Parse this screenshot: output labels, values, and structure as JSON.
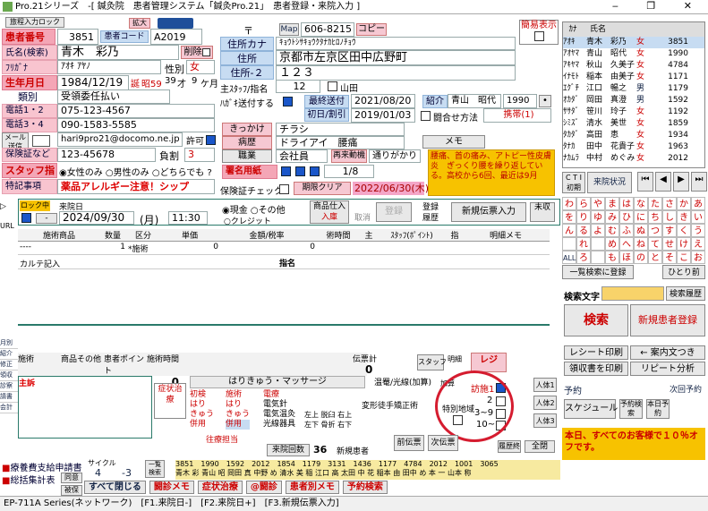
{
  "window": {
    "title": "Pro.21シリーズ　-[ 鍼灸院　患者管理システム「鍼灸Pro.21」　患者登録・来院入力 ]",
    "buttons": "‒ ❐ ✕"
  },
  "patient": {
    "sub_btn": "旅程入力ロック",
    "no_label": "患者番号",
    "no": "3851",
    "code_label": "患者コード",
    "code": "A2019",
    "enlarge": "拡大",
    "name_label": "氏名(検索)",
    "name": "青木　彩乃",
    "delete_btn": "削除",
    "kana_label": "ﾌﾘｶﾞﾅ",
    "kana": "ｱｵｷ ｱﾔﾉ",
    "sex_label": "性別",
    "sex": "女",
    "birth_label": "生年月日",
    "birth": "1984/12/19",
    "era": "誕",
    "age": "昭59",
    "age_y": "39",
    "age_y_u": "才",
    "age_m": "9",
    "age_m_u": "ケ月",
    "type_label": "類別",
    "type": "受領委任払い",
    "tel12_label": "電話1・2",
    "tel12": "075-123-4567",
    "tel34_label": "電話3・4",
    "tel34": "090-1583-5585",
    "mail_label": "メール送信",
    "mail": "hari9pro21@docomo.ne.jp",
    "permit": "許可",
    "ins_label": "保険証など",
    "ins": "123-45678",
    "burden_label": "負割",
    "burden": "3",
    "staff_label": "スタッフ指定",
    "staff_f": "女性のみ",
    "staff_m": "男性のみ",
    "staff_any": "どちらでも",
    "special_label": "特記事項",
    "special": "薬品アレルギー注意！シップ"
  },
  "address": {
    "zip_label": "〒",
    "map": "Map",
    "zip": "606-8215",
    "copy": "コピー",
    "kana_label": "住所カナ",
    "kana": "ｷｮｳﾄｼｻｷｮｳｸﾀﾅｶﾋﾛﾉﾁｮｳ",
    "addr_label": "住所",
    "addr": "京都市左京区田中広野町",
    "addr2_label": "住所-２",
    "addr2": "１２３",
    "staff_label": "主ｽﾀｯﾌ/指名",
    "staff": "12",
    "staff_name": "山田",
    "hagaki_label": "ﾊｶﾞｷ送付する",
    "last_label": "最終送付",
    "last": "2021/08/20",
    "first_label": "初日/割引",
    "first": "2019/01/03",
    "intro_label": "紹介",
    "intro": "青山　昭代",
    "intro_no": "1990",
    "combine": "闘合せ方法",
    "phone": "携帯(1)",
    "trigger_label": "きっかけ",
    "trigger": "チラシ",
    "disease_label": "病歴",
    "disease": "ドライアイ　腰痛",
    "job_label": "職業",
    "job": "会社員",
    "revisit_label": "再来動機",
    "revisit": "通りがかり",
    "memo": "メモ",
    "sign_label": "署名用紙",
    "sign_page": "1/8",
    "ins_check": "保険証チェック",
    "expire_clear": "期限クリア",
    "expire": "2022/06/30(木)",
    "note": "腰痛、首の痛み、アトピー性皮膚炎　ぎっくり腰を繰り返している。高校から6回、最近は9月"
  },
  "easy": "簡易表示",
  "visit": {
    "lock": "ロック中",
    "visit_label": "来院日",
    "date": "2024/09/30",
    "dow": "(月)",
    "time": "11:30",
    "cash": "現金",
    "other": "その他",
    "credit": "クレジット",
    "goods_in": "商品仕入",
    "enter": "入庫",
    "cancel": "取消",
    "register": "登録",
    "history": "登録履歴",
    "new_slip": "新規伝票入力",
    "unread": "未収"
  },
  "table": {
    "headers": [
      "施術商品",
      "数量",
      "区分",
      "単価",
      "金額/税率",
      "術時間",
      "主",
      "ｽﾀｯﾌ(ﾎﾟｲﾝﾄ)",
      "指",
      "明細メモ"
    ],
    "row1": [
      "----",
      "1",
      "*施術",
      "0",
      "0",
      "",
      "",
      "",
      "",
      ""
    ],
    "karte": "カルテ記入",
    "shimei": "指名",
    "sum_headers": [
      "施術",
      "商品その他",
      "患者ポイント",
      "施術時間"
    ],
    "sum_vals": [
      "0",
      "0",
      "0"
    ],
    "slip_total": "伝票計",
    "slip_val": "0",
    "ureceive": "伝票ポイント",
    "staff": "スタッフ",
    "detail": "明細",
    "rezi": "レジ",
    "receipt": "領収"
  },
  "therapy": {
    "main": "主訴",
    "title": "はりきゅう・マッサージ",
    "cancel": "症状治療",
    "first_h": "初検",
    "sejutsu": "施術",
    "denryo": "電療",
    "hari": "はり",
    "kyu": "きゅう",
    "heiyo": "併用",
    "hari2": "はり",
    "kyu2": "きゅう",
    "heiyo2": "併用",
    "elec1": "電気針",
    "elec2": "電気温灸",
    "elec3": "光線器具",
    "onsei": "温罨/光線(加算)",
    "kagai": "加算",
    "left_up": "左上",
    "left_down": "左下",
    "right_up": "右上",
    "right_down": "右下",
    "datsu": "脱臼",
    "kos": "骨折",
    "henkei": "変形徒手矯正術",
    "houmon": "訪施1",
    "n2": "2",
    "n3_9": "3~9",
    "n10": "10~",
    "tokubetsu": "特別地域",
    "person1": "人体1",
    "person2": "人体2",
    "person3": "人体3",
    "visit_reg": "往療担当",
    "visit_btn": "来院回数",
    "visit_count": "36",
    "new_patient": "新規患者",
    "prev_slip": "前伝票",
    "next_slip": "次伝票",
    "history": "履歴終",
    "all": "全閉"
  },
  "right": {
    "ctl": "C T I 初期",
    "kana_col": "ｶﾅ",
    "name_col": "氏名",
    "list": [
      [
        "ｱｵｷ",
        "青木　彩乃",
        "女",
        "3851"
      ],
      [
        "ｱｵﾔﾏ",
        "青山　昭代",
        "女",
        "1990"
      ],
      [
        "ｱｷﾔﾏ",
        "秋山　久美子",
        "女",
        "4784"
      ],
      [
        "ｲﾅﾓﾄ",
        "稲本　由美子",
        "女",
        "1171"
      ],
      [
        "ｴｸﾞﾁ",
        "江口　暢之",
        "男",
        "1179"
      ],
      [
        "ｵｶﾀﾞ",
        "岡田　真澄",
        "男",
        "1592"
      ],
      [
        "ｻｻﾀﾞ",
        "笹川　玲子",
        "女",
        "1192"
      ],
      [
        "ｼﾐｽﾞ",
        "清水　美世",
        "女",
        "1859"
      ],
      [
        "ﾀｶﾀﾞ",
        "高田　恵",
        "女",
        "1934"
      ],
      [
        "ﾀﾅｶ",
        "田中　花貴子",
        "女",
        "1963"
      ],
      [
        "ﾅｶﾑﾗ",
        "中村　めぐみ",
        "女",
        "2012"
      ]
    ],
    "month": "月別",
    "today": "来院状況",
    "kana_rows": [
      [
        "わ",
        "ら",
        "や",
        "ま",
        "は",
        "な",
        "た",
        "さ",
        "か",
        "あ"
      ],
      [
        "を",
        "り",
        "ゆ",
        "み",
        "ひ",
        "に",
        "ち",
        "し",
        "き",
        "い"
      ],
      [
        "ん",
        "る",
        "よ",
        "む",
        "ふ",
        "ぬ",
        "つ",
        "す",
        "く",
        "う"
      ],
      [
        "",
        "れ",
        "",
        "め",
        "へ",
        "ね",
        "て",
        "せ",
        "け",
        "え"
      ],
      [
        "ALL",
        "ろ",
        "",
        "も",
        "ほ",
        "の",
        "と",
        "そ",
        "こ",
        "お"
      ]
    ],
    "search_label": "検索文字",
    "search_hist": "検索履歴",
    "search": "検索",
    "new_patient": "新規患者登録",
    "visit_reg": "一覧検索に登録",
    "hitori": "ひとり前",
    "receipt_print": "レシート印刷",
    "guide": "← 案内文つき",
    "receipt_out": "領収書を印刷",
    "repeat": "リピート分析",
    "yoyaku": "予約",
    "next_yoyaku": "次回予約",
    "schedule": "スケジュール",
    "yoyaku_kensaku": "予約検索",
    "today_yoyaku": "本日予約",
    "notice": "本日、すべてのお客様で１０％オフです。"
  },
  "left_side": {
    "url": "URL",
    "items": [
      "月別",
      "紹介",
      "修正",
      "領収",
      "診察",
      "請書",
      "会計"
    ]
  },
  "bottom": {
    "ryohi": "療養費支給申請書",
    "sofuku": "総括集計表",
    "cycle": "サイクル",
    "cycle_v1": "4",
    "cycle_v2": "-3",
    "ikkan": "一覧検索",
    "doui": "同意",
    "close_all": "すべて閉じる",
    "memo_btn": "闘診メモ",
    "shojo": "症状治療",
    "sindan": "@闘診",
    "patient_memo": "患者別メモ",
    "yoyaku_search": "予約検索",
    "hikae": "被保",
    "hist_no": [
      "3851",
      "1990",
      "1592",
      "2012",
      "1854",
      "1179",
      "3131",
      "1436",
      "1177",
      "4784",
      "2012",
      "1001",
      "3065"
    ],
    "hist_name": "青木 彩 青山 昭 岡田 真 中野 め 清水 美 稲 江口 高 太田 中 花 稲本 由 田中 め 本 一 山本 称",
    "status": "EP-711A Series(ネットワーク)　[F1.来院日-]　[F2.来院日+]　[F3.新規伝票入力]"
  }
}
